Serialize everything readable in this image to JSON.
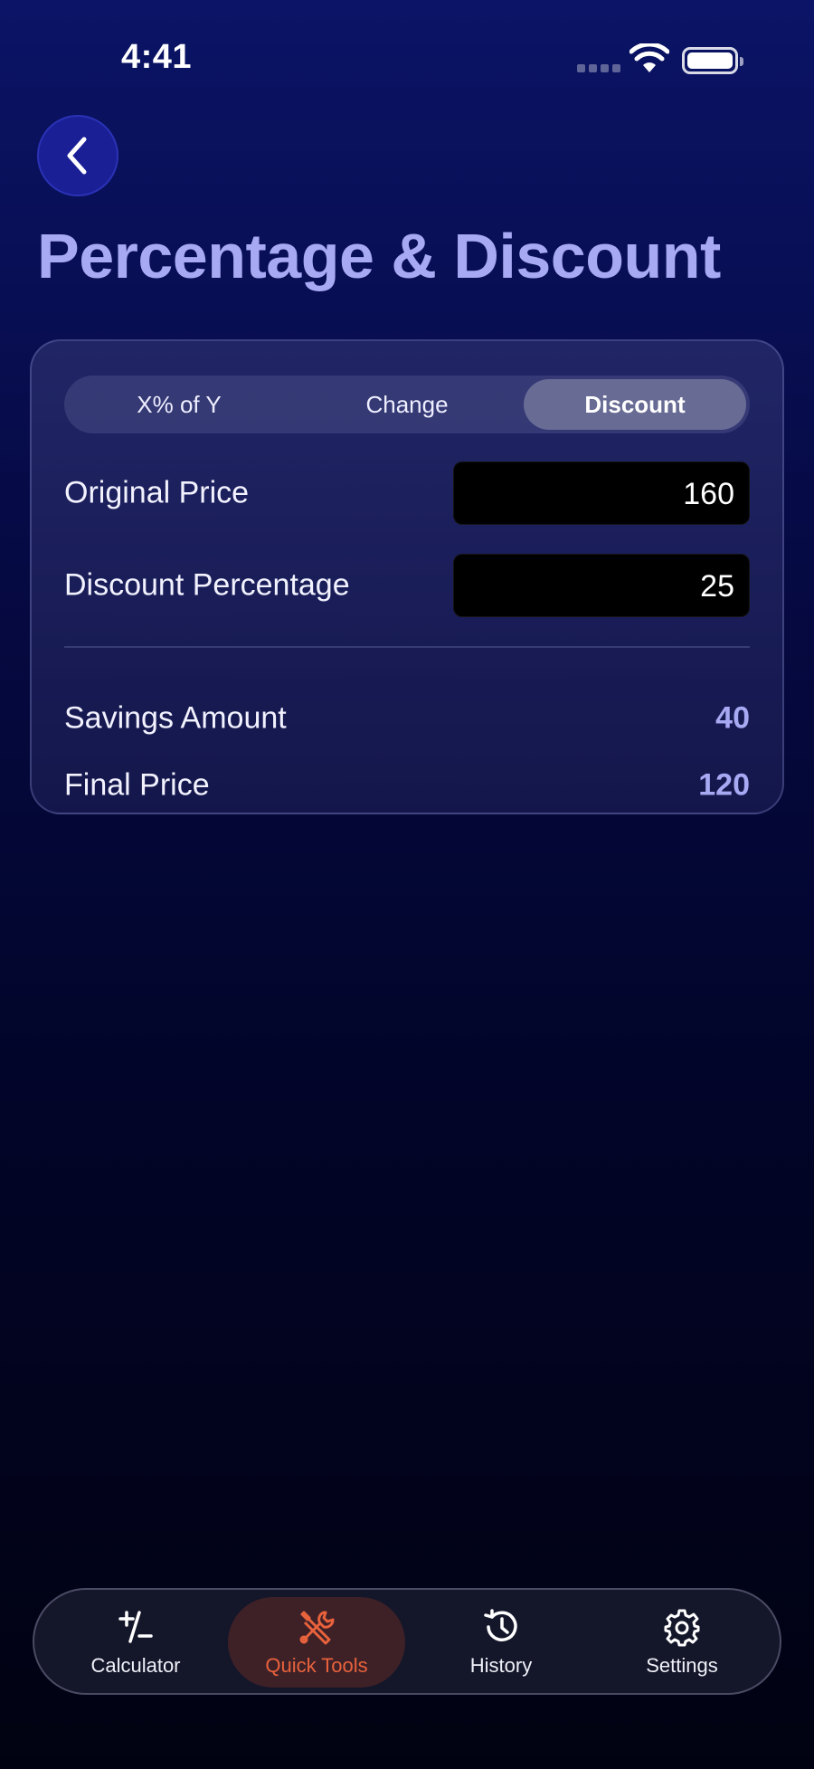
{
  "status_bar": {
    "time": "4:41"
  },
  "header": {
    "back_icon": "chevron-left-icon",
    "title": "Percentage & Discount"
  },
  "segmented_control": {
    "segments": [
      "X% of Y",
      "Change",
      "Discount"
    ],
    "selected": "Discount"
  },
  "form": {
    "original_price_label": "Original Price",
    "original_price_value": "160",
    "discount_percentage_label": "Discount Percentage",
    "discount_percentage_value": "25"
  },
  "results": {
    "savings_label": "Savings Amount",
    "savings_value": "40",
    "final_price_label": "Final Price",
    "final_price_value": "120"
  },
  "tab_bar": {
    "tabs": [
      {
        "label": "Calculator",
        "icon": "plus-minus-icon"
      },
      {
        "label": "Quick Tools",
        "icon": "tools-icon"
      },
      {
        "label": "History",
        "icon": "history-icon"
      },
      {
        "label": "Settings",
        "icon": "gear-icon"
      }
    ],
    "active": "Quick Tools"
  },
  "colors": {
    "accent": "#a7a9f3",
    "active_tab": "#e8623c",
    "back_button": "#1a1f96"
  }
}
